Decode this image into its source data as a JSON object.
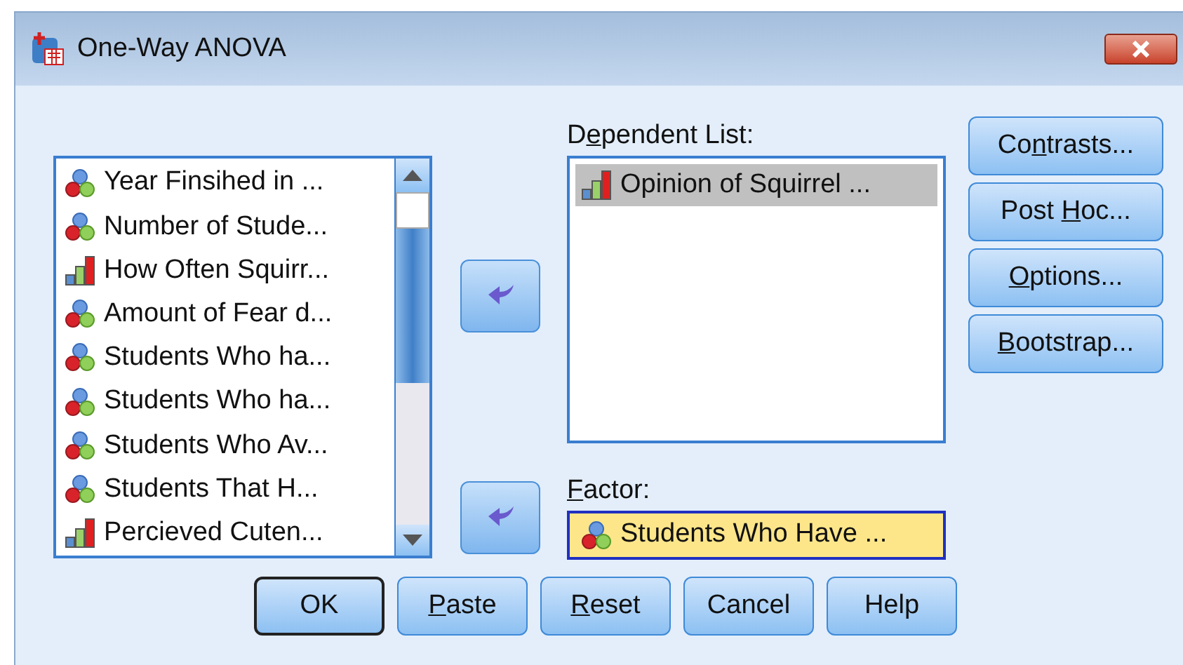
{
  "window": {
    "title": "One-Way ANOVA"
  },
  "variables": [
    {
      "label": "Year Finsihed in ...",
      "kind": "nominal"
    },
    {
      "label": "Number of Stude...",
      "kind": "nominal"
    },
    {
      "label": "How Often Squirr...",
      "kind": "ordinal"
    },
    {
      "label": "Amount of Fear d...",
      "kind": "nominal"
    },
    {
      "label": "Students Who ha...",
      "kind": "nominal"
    },
    {
      "label": "Students Who ha...",
      "kind": "nominal"
    },
    {
      "label": "Students Who Av...",
      "kind": "nominal"
    },
    {
      "label": "Students That H...",
      "kind": "nominal"
    },
    {
      "label": "Percieved Cuten...",
      "kind": "ordinal"
    }
  ],
  "dependent_list": {
    "label": {
      "pre": "D",
      "key": "e",
      "post": "pendent List:"
    },
    "items": [
      {
        "label": "Opinion of Squirrel ...",
        "kind": "ordinal",
        "selected": true
      }
    ]
  },
  "factor": {
    "label": {
      "key": "F",
      "post": "actor:"
    },
    "value": {
      "label": "Students Who Have ...",
      "kind": "nominal"
    }
  },
  "side_buttons": [
    {
      "pre": "Co",
      "key": "n",
      "post": "trasts..."
    },
    {
      "pre": "Post ",
      "key": "H",
      "post": "oc..."
    },
    {
      "key": "O",
      "post": "ptions..."
    },
    {
      "key": "B",
      "post": "ootstrap..."
    }
  ],
  "bottom_buttons": [
    {
      "pre": "OK",
      "default": true
    },
    {
      "key": "P",
      "post": "aste",
      "default": false
    },
    {
      "key": "R",
      "post": "eset",
      "default": false
    },
    {
      "pre": "Cancel",
      "default": false
    },
    {
      "pre": "Help",
      "default": false
    }
  ]
}
